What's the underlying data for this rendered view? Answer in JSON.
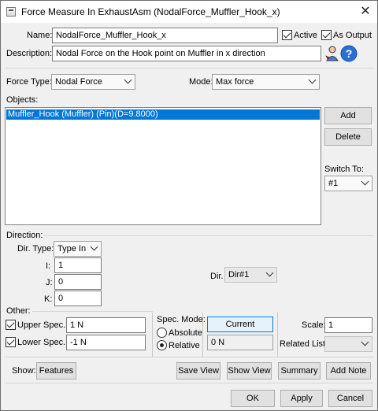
{
  "window": {
    "title": "Force Measure In ExhaustAsm (NodalForce_Muffler_Hook_x)",
    "close_glyph": "✕"
  },
  "name_row": {
    "label": "Name:",
    "value": "NodalForce_Muffler_Hook_x",
    "active_label": "Active",
    "active_checked": true,
    "as_output_label": "As Output",
    "as_output_checked": true
  },
  "description_row": {
    "label": "Description:",
    "value": "Nodal Force on the Hook point on Muffler in x direction",
    "help_icon_glyph": "?"
  },
  "force_type": {
    "label": "Force Type:",
    "value": "Nodal Force"
  },
  "mode": {
    "label": "Mode:",
    "value": "Max force"
  },
  "objects": {
    "label": "Objects:",
    "items": [
      "Muffler_Hook (Muffler) (Pin)(D=9.8000)"
    ],
    "selected_index": 0,
    "add_label": "Add",
    "delete_label": "Delete",
    "switch_to_label": "Switch To:",
    "switch_to_value": "#1"
  },
  "direction": {
    "label": "Direction:",
    "dir_type_label": "Dir. Type:",
    "dir_type_value": "Type In",
    "i_label": "I:",
    "i_value": "1",
    "j_label": "J:",
    "j_value": "0",
    "k_label": "K:",
    "k_value": "0",
    "dir_label": "Dir.",
    "dir_value": "Dir#1"
  },
  "other": {
    "label": "Other:",
    "upper_spec_label": "Upper Spec.:",
    "upper_spec_checked": true,
    "upper_spec_value": "1 N",
    "lower_spec_label": "Lower Spec.:",
    "lower_spec_checked": true,
    "lower_spec_value": "-1 N",
    "spec_mode_label": "Spec. Mode:",
    "absolute_label": "Absolute",
    "relative_label": "Relative",
    "spec_mode_selected": "Relative",
    "current_label": "Current",
    "current_value": "0 N",
    "scale_label": "Scale:",
    "scale_value": "1",
    "related_list_label": "Related List:",
    "related_list_value": ""
  },
  "show_row": {
    "label": "Show:",
    "features_label": "Features",
    "save_view_label": "Save View",
    "show_view_label": "Show View",
    "summary_label": "Summary",
    "add_note_label": "Add Note"
  },
  "footer": {
    "ok_label": "OK",
    "apply_label": "Apply",
    "cancel_label": "Cancel"
  },
  "colors": {
    "selection": "#0078d7",
    "dialog_bg": "#f0f0f0"
  }
}
